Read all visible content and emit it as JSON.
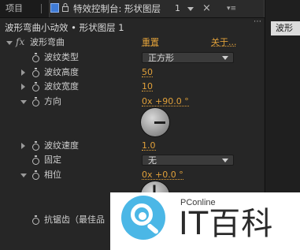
{
  "tabs": {
    "project_label": "项目",
    "active_title": "特效控制台: 形状图层",
    "active_number": "1",
    "right_tab_label": "波形"
  },
  "breadcrumb": "波形弯曲小动效 • 形状图层 1",
  "effect": {
    "name": "波形弯曲",
    "reset_label": "重置",
    "about_label": "关于..."
  },
  "properties": [
    {
      "label": "波纹类型",
      "kind": "select",
      "value": "正方形"
    },
    {
      "label": "波纹高度",
      "kind": "number",
      "value": "50"
    },
    {
      "label": "波纹宽度",
      "kind": "number",
      "value": "10"
    },
    {
      "label": "方向",
      "kind": "angle",
      "value": "0x +90.0 °"
    },
    {
      "label": "波纹速度",
      "kind": "number",
      "value": "1.0"
    },
    {
      "label": "固定",
      "kind": "select",
      "value": "无"
    },
    {
      "label": "相位",
      "kind": "angle",
      "value": "0x +0.0 °"
    },
    {
      "label": "抗锯齿（最佳品",
      "kind": "text",
      "value": ""
    }
  ],
  "dials": {
    "direction_degrees": 90,
    "phase_degrees": 0
  },
  "watermark": {
    "small_text": "PConline",
    "big_text": "IT百科"
  },
  "colors": {
    "accent": "#e0a03a",
    "background": "#262626",
    "tab_blue": "#3f7bd6",
    "watermark_blue": "#4bb7e6"
  }
}
